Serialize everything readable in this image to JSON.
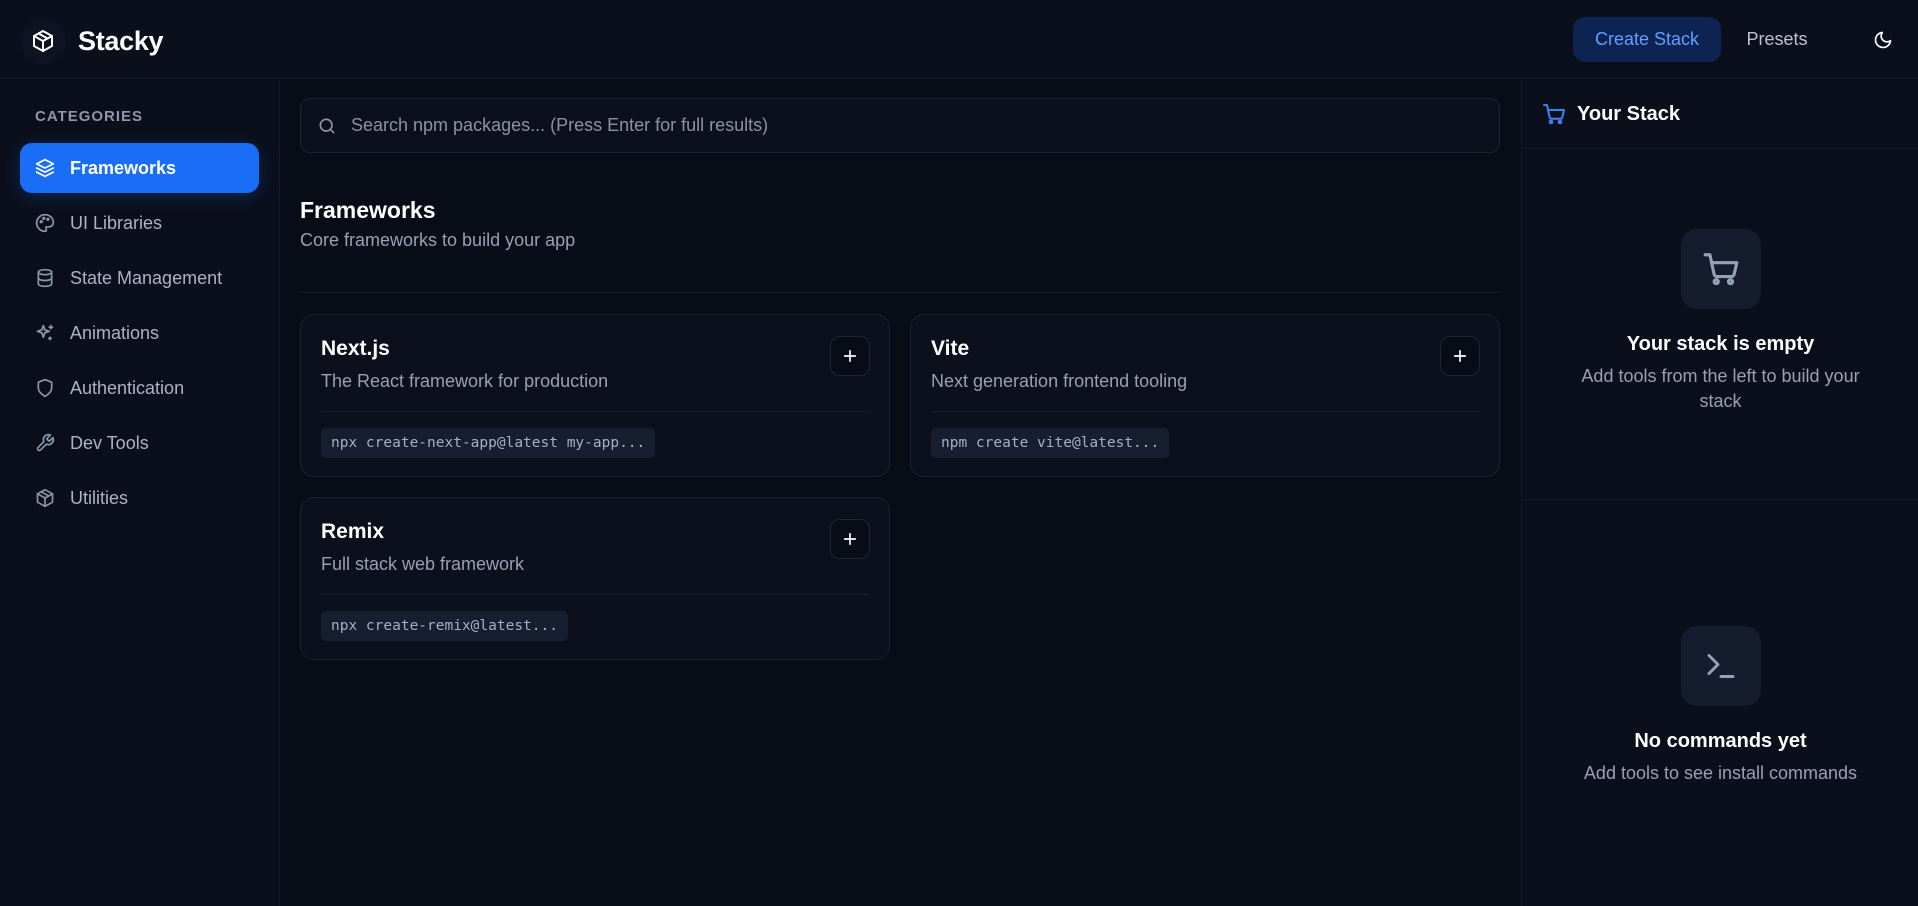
{
  "app": {
    "name": "Stacky"
  },
  "header": {
    "create_label": "Create Stack",
    "presets_label": "Presets"
  },
  "sidebar": {
    "heading": "CATEGORIES",
    "items": [
      {
        "label": "Frameworks",
        "icon": "layers-icon",
        "active": true
      },
      {
        "label": "UI Libraries",
        "icon": "palette-icon",
        "active": false
      },
      {
        "label": "State Management",
        "icon": "database-icon",
        "active": false
      },
      {
        "label": "Animations",
        "icon": "sparkles-icon",
        "active": false
      },
      {
        "label": "Authentication",
        "icon": "shield-icon",
        "active": false
      },
      {
        "label": "Dev Tools",
        "icon": "wrench-icon",
        "active": false
      },
      {
        "label": "Utilities",
        "icon": "box-icon",
        "active": false
      }
    ]
  },
  "search": {
    "placeholder": "Search npm packages... (Press Enter for full results)",
    "value": ""
  },
  "section": {
    "title": "Frameworks",
    "subtitle": "Core frameworks to build your app"
  },
  "packages": [
    {
      "name": "Next.js",
      "description": "The React framework for production",
      "command": "npx create-next-app@latest my-app..."
    },
    {
      "name": "Vite",
      "description": "Next generation frontend tooling",
      "command": "npm create vite@latest..."
    },
    {
      "name": "Remix",
      "description": "Full stack web framework",
      "command": "npx create-remix@latest..."
    }
  ],
  "stack_panel": {
    "title": "Your Stack",
    "empty_title": "Your stack is empty",
    "empty_sub": "Add tools from the left to build your stack",
    "commands_title": "No commands yet",
    "commands_sub": "Add tools to see install commands"
  },
  "colors": {
    "accent": "#1a6ef5",
    "background": "#080c16",
    "panel": "#0a0f1b"
  }
}
